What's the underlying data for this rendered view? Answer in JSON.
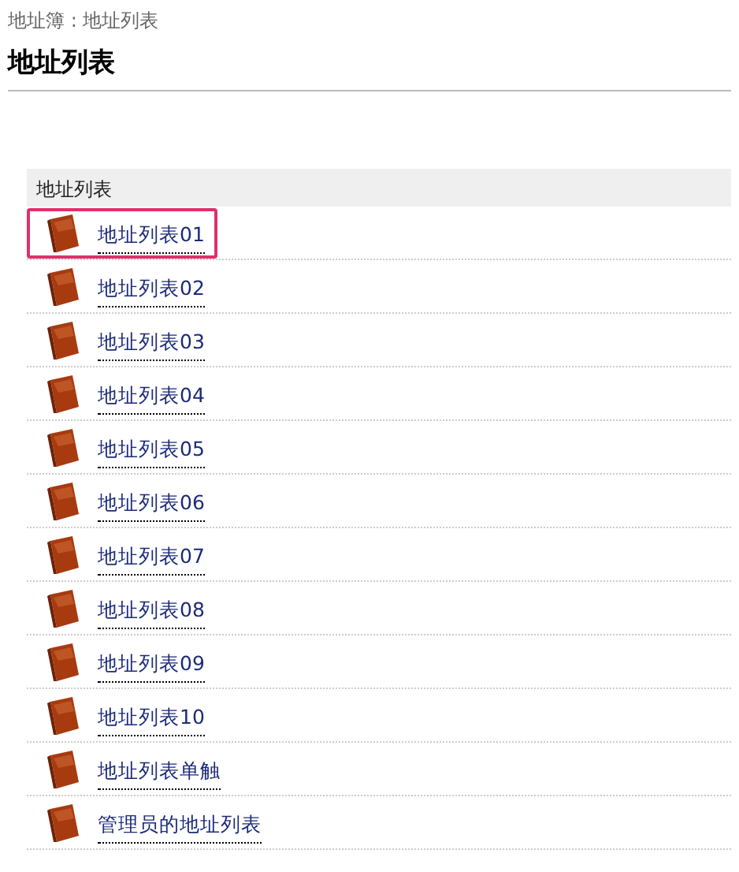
{
  "breadcrumb": "地址簿 : 地址列表",
  "title": "地址列表",
  "list": {
    "header": "地址列表",
    "items": [
      {
        "label": "地址列表01",
        "selected": true
      },
      {
        "label": "地址列表02",
        "selected": false
      },
      {
        "label": "地址列表03",
        "selected": false
      },
      {
        "label": "地址列表04",
        "selected": false
      },
      {
        "label": "地址列表05",
        "selected": false
      },
      {
        "label": "地址列表06",
        "selected": false
      },
      {
        "label": "地址列表07",
        "selected": false
      },
      {
        "label": "地址列表08",
        "selected": false
      },
      {
        "label": "地址列表09",
        "selected": false
      },
      {
        "label": "地址列表10",
        "selected": false
      },
      {
        "label": "地址列表单触",
        "selected": false
      },
      {
        "label": "管理员的地址列表",
        "selected": false
      }
    ]
  }
}
